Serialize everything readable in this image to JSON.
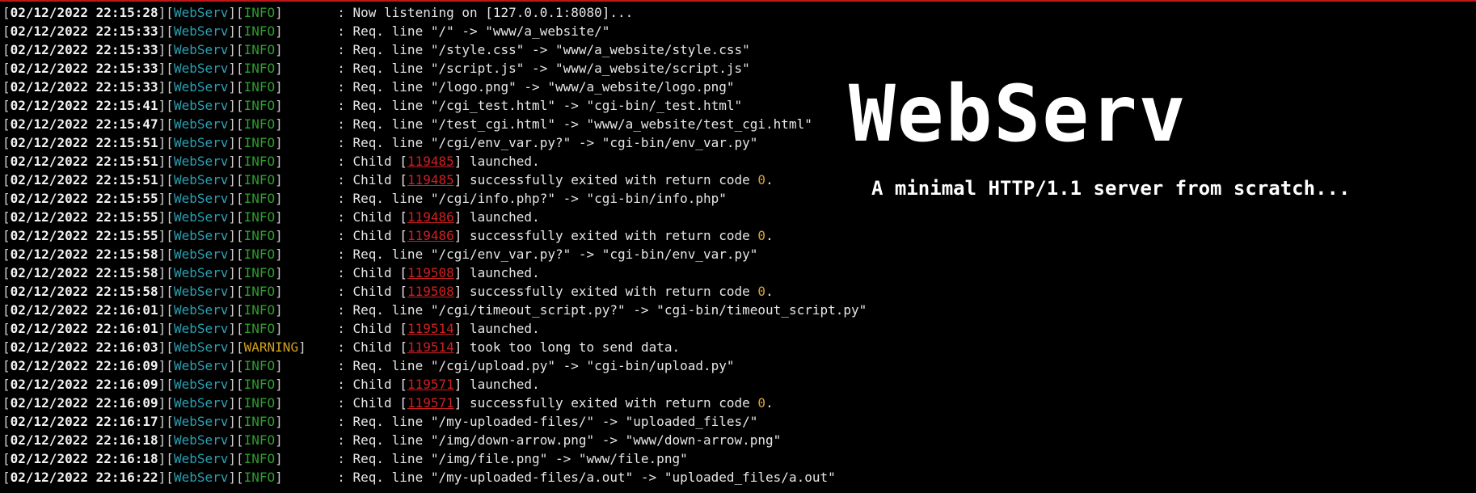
{
  "colors": {
    "background": "#000000",
    "timestamp": "#f2f2f2",
    "module": "#2aa1b3",
    "info": "#2e9e2e",
    "warning": "#d0a020",
    "pid": "#d02020",
    "code": "#d8a23a",
    "top_border": "#c01818"
  },
  "banner": {
    "title": "WebServ",
    "subtitle": "A minimal HTTP/1.1 server from scratch..."
  },
  "log": [
    {
      "ts": "02/12/2022 22:15:28",
      "module": "WebServ",
      "level": "INFO",
      "parts": [
        {
          "t": "Now listening on [127.0.0.1:8080]..."
        }
      ]
    },
    {
      "ts": "02/12/2022 22:15:33",
      "module": "WebServ",
      "level": "INFO",
      "parts": [
        {
          "t": "Req. line \"/\" -> \"www/a_website/\""
        }
      ]
    },
    {
      "ts": "02/12/2022 22:15:33",
      "module": "WebServ",
      "level": "INFO",
      "parts": [
        {
          "t": "Req. line \"/style.css\" -> \"www/a_website/style.css\""
        }
      ]
    },
    {
      "ts": "02/12/2022 22:15:33",
      "module": "WebServ",
      "level": "INFO",
      "parts": [
        {
          "t": "Req. line \"/script.js\" -> \"www/a_website/script.js\""
        }
      ]
    },
    {
      "ts": "02/12/2022 22:15:33",
      "module": "WebServ",
      "level": "INFO",
      "parts": [
        {
          "t": "Req. line \"/logo.png\" -> \"www/a_website/logo.png\""
        }
      ]
    },
    {
      "ts": "02/12/2022 22:15:41",
      "module": "WebServ",
      "level": "INFO",
      "parts": [
        {
          "t": "Req. line \"/cgi_test.html\" -> \"cgi-bin/_test.html\""
        }
      ]
    },
    {
      "ts": "02/12/2022 22:15:47",
      "module": "WebServ",
      "level": "INFO",
      "parts": [
        {
          "t": "Req. line \"/test_cgi.html\" -> \"www/a_website/test_cgi.html\""
        }
      ]
    },
    {
      "ts": "02/12/2022 22:15:51",
      "module": "WebServ",
      "level": "INFO",
      "parts": [
        {
          "t": "Req. line \"/cgi/env_var.py?\" -> \"cgi-bin/env_var.py\""
        }
      ]
    },
    {
      "ts": "02/12/2022 22:15:51",
      "module": "WebServ",
      "level": "INFO",
      "parts": [
        {
          "t": "Child ["
        },
        {
          "t": "119485",
          "c": "pid"
        },
        {
          "t": "] launched."
        }
      ]
    },
    {
      "ts": "02/12/2022 22:15:51",
      "module": "WebServ",
      "level": "INFO",
      "parts": [
        {
          "t": "Child ["
        },
        {
          "t": "119485",
          "c": "pid"
        },
        {
          "t": "] successfully exited with return code "
        },
        {
          "t": "0",
          "c": "num"
        },
        {
          "t": "."
        }
      ]
    },
    {
      "ts": "02/12/2022 22:15:55",
      "module": "WebServ",
      "level": "INFO",
      "parts": [
        {
          "t": "Req. line \"/cgi/info.php?\" -> \"cgi-bin/info.php\""
        }
      ]
    },
    {
      "ts": "02/12/2022 22:15:55",
      "module": "WebServ",
      "level": "INFO",
      "parts": [
        {
          "t": "Child ["
        },
        {
          "t": "119486",
          "c": "pid"
        },
        {
          "t": "] launched."
        }
      ]
    },
    {
      "ts": "02/12/2022 22:15:55",
      "module": "WebServ",
      "level": "INFO",
      "parts": [
        {
          "t": "Child ["
        },
        {
          "t": "119486",
          "c": "pid"
        },
        {
          "t": "] successfully exited with return code "
        },
        {
          "t": "0",
          "c": "num"
        },
        {
          "t": "."
        }
      ]
    },
    {
      "ts": "02/12/2022 22:15:58",
      "module": "WebServ",
      "level": "INFO",
      "parts": [
        {
          "t": "Req. line \"/cgi/env_var.py?\" -> \"cgi-bin/env_var.py\""
        }
      ]
    },
    {
      "ts": "02/12/2022 22:15:58",
      "module": "WebServ",
      "level": "INFO",
      "parts": [
        {
          "t": "Child ["
        },
        {
          "t": "119508",
          "c": "pid"
        },
        {
          "t": "] launched."
        }
      ]
    },
    {
      "ts": "02/12/2022 22:15:58",
      "module": "WebServ",
      "level": "INFO",
      "parts": [
        {
          "t": "Child ["
        },
        {
          "t": "119508",
          "c": "pid"
        },
        {
          "t": "] successfully exited with return code "
        },
        {
          "t": "0",
          "c": "num"
        },
        {
          "t": "."
        }
      ]
    },
    {
      "ts": "02/12/2022 22:16:01",
      "module": "WebServ",
      "level": "INFO",
      "parts": [
        {
          "t": "Req. line \"/cgi/timeout_script.py?\" -> \"cgi-bin/timeout_script.py\""
        }
      ]
    },
    {
      "ts": "02/12/2022 22:16:01",
      "module": "WebServ",
      "level": "INFO",
      "parts": [
        {
          "t": "Child ["
        },
        {
          "t": "119514",
          "c": "pid"
        },
        {
          "t": "] launched."
        }
      ]
    },
    {
      "ts": "02/12/2022 22:16:03",
      "module": "WebServ",
      "level": "WARNING",
      "parts": [
        {
          "t": "Child ["
        },
        {
          "t": "119514",
          "c": "pid"
        },
        {
          "t": "] took too long to send data."
        }
      ]
    },
    {
      "ts": "02/12/2022 22:16:09",
      "module": "WebServ",
      "level": "INFO",
      "parts": [
        {
          "t": "Req. line \"/cgi/upload.py\" -> \"cgi-bin/upload.py\""
        }
      ]
    },
    {
      "ts": "02/12/2022 22:16:09",
      "module": "WebServ",
      "level": "INFO",
      "parts": [
        {
          "t": "Child ["
        },
        {
          "t": "119571",
          "c": "pid"
        },
        {
          "t": "] launched."
        }
      ]
    },
    {
      "ts": "02/12/2022 22:16:09",
      "module": "WebServ",
      "level": "INFO",
      "parts": [
        {
          "t": "Child ["
        },
        {
          "t": "119571",
          "c": "pid"
        },
        {
          "t": "] successfully exited with return code "
        },
        {
          "t": "0",
          "c": "num"
        },
        {
          "t": "."
        }
      ]
    },
    {
      "ts": "02/12/2022 22:16:17",
      "module": "WebServ",
      "level": "INFO",
      "parts": [
        {
          "t": "Req. line \"/my-uploaded-files/\" -> \"uploaded_files/\""
        }
      ]
    },
    {
      "ts": "02/12/2022 22:16:18",
      "module": "WebServ",
      "level": "INFO",
      "parts": [
        {
          "t": "Req. line \"/img/down-arrow.png\" -> \"www/down-arrow.png\""
        }
      ]
    },
    {
      "ts": "02/12/2022 22:16:18",
      "module": "WebServ",
      "level": "INFO",
      "parts": [
        {
          "t": "Req. line \"/img/file.png\" -> \"www/file.png\""
        }
      ]
    },
    {
      "ts": "02/12/2022 22:16:22",
      "module": "WebServ",
      "level": "INFO",
      "parts": [
        {
          "t": "Req. line \"/my-uploaded-files/a.out\" -> \"uploaded_files/a.out\""
        }
      ]
    }
  ]
}
